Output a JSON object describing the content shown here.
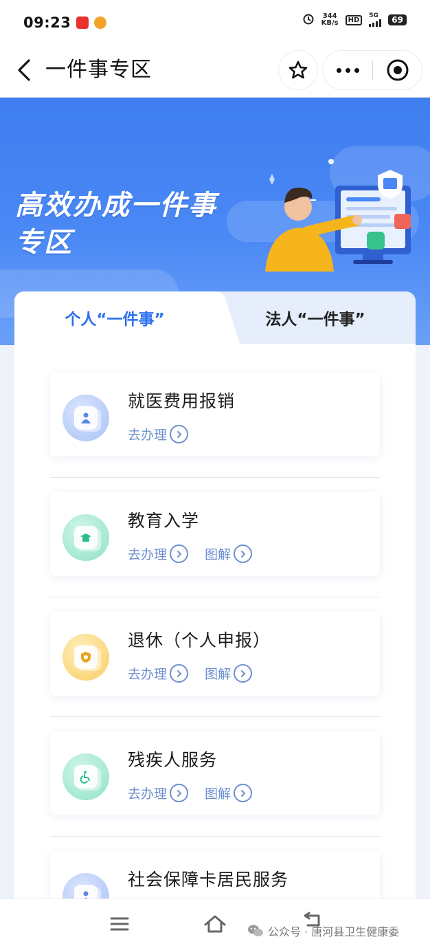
{
  "status_bar": {
    "time": "09:23",
    "network_speed_value": "344",
    "network_speed_unit": "KB/s",
    "hd_label": "HD",
    "signal_label": "5G",
    "battery": "69"
  },
  "nav": {
    "title": "一件事专区"
  },
  "banner": {
    "title_line1": "高效办成一件事",
    "title_line2": "专区"
  },
  "tabs": [
    {
      "label": "个人“一件事”",
      "active": true
    },
    {
      "label": "法人“一件事”",
      "active": false
    }
  ],
  "services": [
    {
      "name": "就医费用报销",
      "icon": "medical-person-icon",
      "icon_color": "#a9c1f6",
      "actions": [
        "去办理"
      ]
    },
    {
      "name": "教育入学",
      "icon": "graduation-cap-icon",
      "icon_color": "#8ee2c5",
      "actions": [
        "去办理",
        "图解"
      ]
    },
    {
      "name": "退休（个人申报）",
      "icon": "retirement-shield-icon",
      "icon_color": "#f8cd5e",
      "actions": [
        "去办理",
        "图解"
      ]
    },
    {
      "name": "残疾人服务",
      "icon": "wheelchair-icon",
      "icon_color": "#8ee2c5",
      "actions": [
        "去办理",
        "图解"
      ]
    },
    {
      "name": "社会保障卡居民服务",
      "icon": "social-card-person-icon",
      "icon_color": "#a9c1f6",
      "actions": []
    }
  ],
  "watermark": {
    "text": "公众号 · 唐河县卫生健康委"
  },
  "colors": {
    "accent": "#2a6ff0",
    "banner": "#4a88f5",
    "action_text": "#6d8fcf"
  }
}
